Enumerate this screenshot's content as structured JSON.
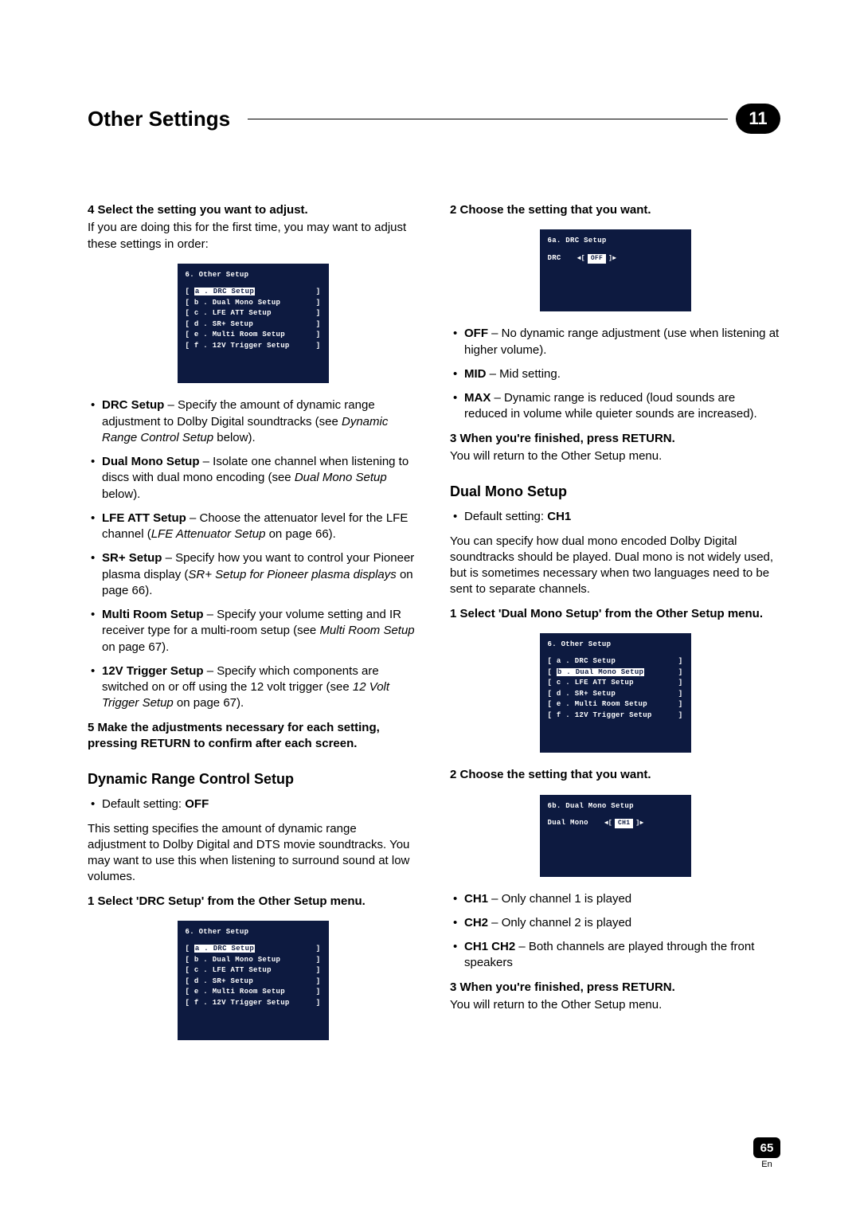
{
  "header": {
    "title": "Other Settings",
    "chapter": "11"
  },
  "left": {
    "step4_label": "4   Select the setting you want to adjust.",
    "step4_note": "If you are doing this for the first time, you may want to adjust these settings in order:",
    "osd1": {
      "title": "6. Other Setup",
      "items": [
        "a . DRC Setup",
        "b . Dual Mono Setup",
        "c . LFE ATT Setup",
        "d . SR+ Setup",
        "e . Multi Room Setup",
        "f . 12V Trigger Setup"
      ],
      "highlight_index": 0
    },
    "bullets": [
      {
        "b": "DRC Setup",
        "t1": " – Specify the amount of dynamic range adjustment to Dolby Digital soundtracks (see ",
        "i": "Dynamic Range Control Setup",
        "t2": " below)."
      },
      {
        "b": "Dual Mono Setup",
        "t1": " – Isolate one channel when listening to discs with dual mono encoding (see ",
        "i": "Dual Mono Setup",
        "t2": " below)."
      },
      {
        "b": "LFE ATT Setup",
        "t1": " – Choose the attenuator level for the LFE channel (",
        "i": "LFE Attenuator Setup",
        "t2": " on page 66)."
      },
      {
        "b": "SR+ Setup",
        "t1": " – Specify how you want to control your Pioneer plasma display (",
        "i": "SR+ Setup for Pioneer plasma displays",
        "t2": " on page 66)."
      },
      {
        "b": "Multi Room Setup",
        "t1": " – Specify your volume setting and IR receiver type for a multi-room setup (see ",
        "i": "Multi Room Setup",
        "t2": " on page 67)."
      },
      {
        "b": "12V Trigger Setup",
        "t1": " – Specify which components are switched on or off using the 12 volt trigger (see ",
        "i": "12 Volt Trigger Setup",
        "t2": " on page 67)."
      }
    ],
    "step5_label": "5   Make the adjustments necessary for each setting, pressing RETURN to confirm after each screen.",
    "drc_heading": "Dynamic Range Control Setup",
    "drc_default_prefix": "Default setting: ",
    "drc_default_value": "OFF",
    "drc_para": "This setting specifies the amount of dynamic range adjustment to Dolby Digital and DTS movie soundtracks. You may want to use this when listening to surround sound at low volumes.",
    "drc_step1_label": "1   Select 'DRC Setup' from the Other Setup menu.",
    "osd2": {
      "title": "6. Other Setup",
      "items": [
        "a . DRC Setup",
        "b . Dual Mono Setup",
        "c . LFE ATT Setup",
        "d . SR+ Setup",
        "e . Multi Room Setup",
        "f . 12V Trigger Setup"
      ],
      "highlight_index": 0
    }
  },
  "right": {
    "step2_label": "2   Choose the setting that you want.",
    "osd3": {
      "title": "6a. DRC Setup",
      "param": "DRC",
      "value": "OFF"
    },
    "drc_opts": [
      {
        "b": "OFF",
        "t": " – No dynamic range adjustment (use when listening at higher volume)."
      },
      {
        "b": "MID",
        "t": " – Mid setting."
      },
      {
        "b": "MAX",
        "t": " – Dynamic range is reduced (loud sounds are reduced in volume while quieter sounds are increased)."
      }
    ],
    "step3_label": "3   When you're finished, press RETURN.",
    "step3_note": "You will return to the Other Setup menu.",
    "dm_heading": "Dual Mono Setup",
    "dm_default_prefix": "Default setting: ",
    "dm_default_value": "CH1",
    "dm_para": "You can specify how dual mono encoded Dolby Digital soundtracks should be played. Dual mono is not widely used, but is sometimes necessary when two languages need to be sent to separate channels.",
    "dm_step1_label": "1   Select 'Dual Mono Setup' from the Other Setup menu.",
    "osd4": {
      "title": "6. Other Setup",
      "items": [
        "a . DRC Setup",
        "b . Dual Mono Setup",
        "c . LFE ATT Setup",
        "d . SR+ Setup",
        "e . Multi Room Setup",
        "f . 12V Trigger Setup"
      ],
      "highlight_index": 1
    },
    "dm_step2_label": "2   Choose the setting that you want.",
    "osd5": {
      "title": "6b. Dual Mono Setup",
      "param": "Dual Mono",
      "value": "CH1"
    },
    "dm_opts": [
      {
        "b": "CH1",
        "t": " – Only channel 1 is played"
      },
      {
        "b": "CH2",
        "t": " – Only channel 2 is played"
      },
      {
        "b": "CH1 CH2",
        "t": " – Both channels are played through the front speakers"
      }
    ],
    "dm_step3_label": "3   When you're finished, press RETURN.",
    "dm_step3_note": "You will return to the Other Setup menu."
  },
  "footer": {
    "page": "65",
    "lang": "En"
  }
}
